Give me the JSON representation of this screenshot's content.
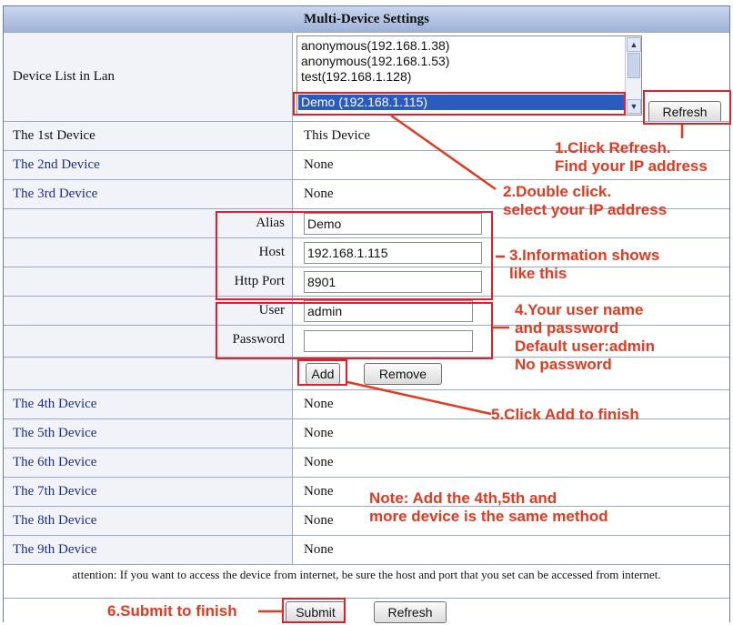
{
  "title": "Multi-Device Settings",
  "device_list": {
    "label": "Device List in Lan",
    "items": [
      "anonymous(192.168.1.38)",
      "anonymous(192.168.1.53)",
      "test(192.168.1.128)",
      "Demo (192.168.1.115)"
    ],
    "selected": "Demo (192.168.1.115)",
    "refresh_label": "Refresh"
  },
  "devices_top": [
    {
      "label": "The 1st Device",
      "value": "This Device"
    },
    {
      "label": "The 2nd Device",
      "value": "None"
    },
    {
      "label": "The 3rd Device",
      "value": "None"
    }
  ],
  "form": {
    "alias_label": "Alias",
    "alias_value": "Demo",
    "host_label": "Host",
    "host_value": "192.168.1.115",
    "port_label": "Http Port",
    "port_value": "8901",
    "user_label": "User",
    "user_value": "admin",
    "password_label": "Password",
    "password_value": "",
    "add_label": "Add",
    "remove_label": "Remove"
  },
  "devices_bottom": [
    {
      "label": "The 4th Device",
      "value": "None"
    },
    {
      "label": "The 5th Device",
      "value": "None"
    },
    {
      "label": "The 6th Device",
      "value": "None"
    },
    {
      "label": "The 7th Device",
      "value": "None"
    },
    {
      "label": "The 8th Device",
      "value": "None"
    },
    {
      "label": "The 9th Device",
      "value": "None"
    }
  ],
  "attention": "attention: If you want to access the device from internet, be sure the host and port that you set can be accessed from internet.",
  "submit_label": "Submit",
  "bottom_refresh_label": "Refresh",
  "annotations": {
    "a1": "1.Click Refresh.\nFind your IP address",
    "a2": "2.Double click.\nselect your IP address",
    "a3": "3.Information shows\nlike this",
    "a4": "4.Your user name\nand password\nDefault user:admin\nNo password",
    "a5": "5.Click Add to finish",
    "a6": "Note: Add the 4th,5th and\nmore device is the same method",
    "a7": "6.Submit to finish"
  },
  "colors": {
    "annotation": "#e03a20",
    "header": "#b3c3e4",
    "selected": "#2c5bbf"
  }
}
